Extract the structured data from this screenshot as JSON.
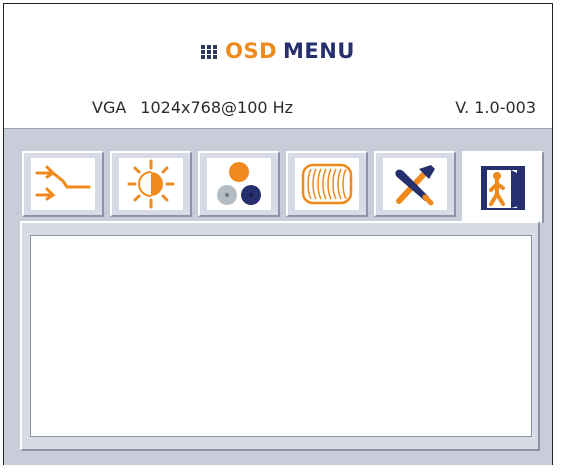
{
  "title": {
    "osd": "OSD",
    "menu": "MENU"
  },
  "status": {
    "input": "VGA",
    "resolution": "1024x768@100 Hz",
    "version": "V. 1.0-003"
  },
  "tabs": [
    {
      "icon": "input-select-icon",
      "active": false
    },
    {
      "icon": "brightness-icon",
      "active": false
    },
    {
      "icon": "color-icon",
      "active": false
    },
    {
      "icon": "geometry-icon",
      "active": false
    },
    {
      "icon": "tools-icon",
      "active": false
    },
    {
      "icon": "exit-icon",
      "active": true
    }
  ],
  "colors": {
    "accent_orange": "#f08a1c",
    "accent_navy": "#27306e",
    "frame_gray": "#c9cdd9"
  }
}
